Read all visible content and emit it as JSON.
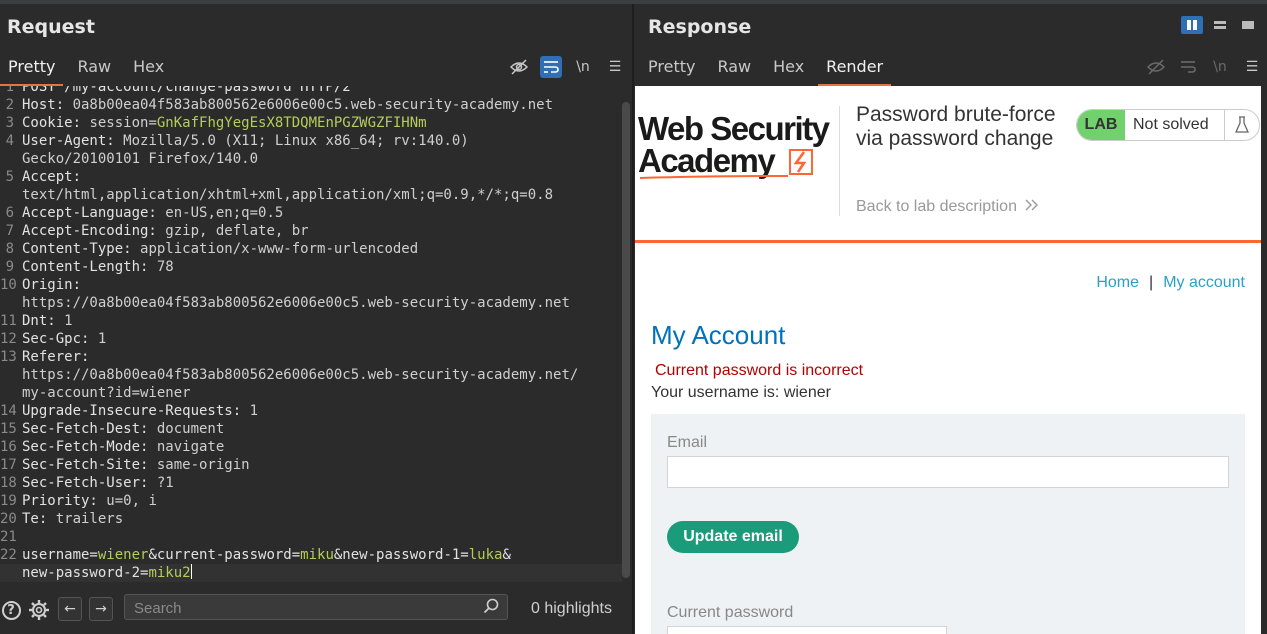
{
  "request": {
    "title": "Request",
    "tabs": [
      "Pretty",
      "Raw",
      "Hex"
    ],
    "active_tab": "Pretty",
    "tool_newline": "\\n",
    "lines": [
      {
        "n": "1",
        "parts": [
          [
            "k",
            "POST /my-account/change-password HTTP/2"
          ]
        ]
      },
      {
        "n": "2",
        "parts": [
          [
            "k",
            "Host: "
          ],
          [
            "v",
            "0a8b00ea04f583ab800562e6006e00c5.web-security-academy.net"
          ]
        ]
      },
      {
        "n": "3",
        "parts": [
          [
            "k",
            "Cookie: "
          ],
          [
            "v",
            "session="
          ],
          [
            "g",
            "GnKafFhgYegEsX8TDQMEnPGZWGZFIHNm"
          ]
        ]
      },
      {
        "n": "4",
        "parts": [
          [
            "k",
            "User-Agent: "
          ],
          [
            "v",
            "Mozilla/5.0 (X11; Linux x86_64; rv:140.0)"
          ]
        ]
      },
      {
        "n": "",
        "parts": [
          [
            "v",
            "Gecko/20100101 Firefox/140.0"
          ]
        ]
      },
      {
        "n": "5",
        "parts": [
          [
            "k",
            "Accept:"
          ]
        ]
      },
      {
        "n": "",
        "parts": [
          [
            "v",
            "text/html,application/xhtml+xml,application/xml;q=0.9,*/*;q=0.8"
          ]
        ]
      },
      {
        "n": "6",
        "parts": [
          [
            "k",
            "Accept-Language: "
          ],
          [
            "v",
            "en-US,en;q=0.5"
          ]
        ]
      },
      {
        "n": "7",
        "parts": [
          [
            "k",
            "Accept-Encoding: "
          ],
          [
            "v",
            "gzip, deflate, br"
          ]
        ]
      },
      {
        "n": "8",
        "parts": [
          [
            "k",
            "Content-Type: "
          ],
          [
            "v",
            "application/x-www-form-urlencoded"
          ]
        ]
      },
      {
        "n": "9",
        "parts": [
          [
            "k",
            "Content-Length: "
          ],
          [
            "v",
            "78"
          ]
        ]
      },
      {
        "n": "10",
        "parts": [
          [
            "k",
            "Origin:"
          ]
        ]
      },
      {
        "n": "",
        "parts": [
          [
            "v",
            "https://0a8b00ea04f583ab800562e6006e00c5.web-security-academy.net"
          ]
        ]
      },
      {
        "n": "11",
        "parts": [
          [
            "k",
            "Dnt: "
          ],
          [
            "v",
            "1"
          ]
        ]
      },
      {
        "n": "12",
        "parts": [
          [
            "k",
            "Sec-Gpc: "
          ],
          [
            "v",
            "1"
          ]
        ]
      },
      {
        "n": "13",
        "parts": [
          [
            "k",
            "Referer:"
          ]
        ]
      },
      {
        "n": "",
        "parts": [
          [
            "v",
            "https://0a8b00ea04f583ab800562e6006e00c5.web-security-academy.net/"
          ]
        ]
      },
      {
        "n": "",
        "parts": [
          [
            "v",
            "my-account?id=wiener"
          ]
        ]
      },
      {
        "n": "14",
        "parts": [
          [
            "k",
            "Upgrade-Insecure-Requests: "
          ],
          [
            "v",
            "1"
          ]
        ]
      },
      {
        "n": "15",
        "parts": [
          [
            "k",
            "Sec-Fetch-Dest: "
          ],
          [
            "v",
            "document"
          ]
        ]
      },
      {
        "n": "16",
        "parts": [
          [
            "k",
            "Sec-Fetch-Mode: "
          ],
          [
            "v",
            "navigate"
          ]
        ]
      },
      {
        "n": "17",
        "parts": [
          [
            "k",
            "Sec-Fetch-Site: "
          ],
          [
            "v",
            "same-origin"
          ]
        ]
      },
      {
        "n": "18",
        "parts": [
          [
            "k",
            "Sec-Fetch-User: "
          ],
          [
            "v",
            "?1"
          ]
        ]
      },
      {
        "n": "19",
        "parts": [
          [
            "k",
            "Priority: "
          ],
          [
            "v",
            "u=0, i"
          ]
        ]
      },
      {
        "n": "20",
        "parts": [
          [
            "k",
            "Te: "
          ],
          [
            "v",
            "trailers"
          ]
        ]
      },
      {
        "n": "21",
        "parts": []
      },
      {
        "n": "22",
        "parts": [
          [
            "k",
            "username="
          ],
          [
            "g",
            "wiener"
          ],
          [
            "k",
            "&current-password="
          ],
          [
            "g",
            "miku"
          ],
          [
            "k",
            "&new-password-1="
          ],
          [
            "g",
            "luka"
          ],
          [
            "k",
            "&"
          ]
        ]
      },
      {
        "n": "",
        "parts": [
          [
            "k",
            "new-password-2="
          ],
          [
            "g",
            "miku2"
          ]
        ]
      }
    ],
    "search_placeholder": "Search",
    "highlights": "0 highlights"
  },
  "response": {
    "title": "Response",
    "tabs": [
      "Pretty",
      "Raw",
      "Hex",
      "Render"
    ],
    "active_tab": "Render",
    "tool_newline": "\\n",
    "page": {
      "logo_line1": "Web Security",
      "logo_line2": "Academy",
      "lab_title": "Password brute-force via password change",
      "back_link": "Back to lab description",
      "lab_badge": "LAB",
      "lab_status": "Not solved",
      "nav_home": "Home",
      "nav_sep": "|",
      "nav_account": "My account",
      "heading": "My Account",
      "error": "Current password is incorrect",
      "username_text": "Your username is: wiener",
      "email_label": "Email",
      "update_button": "Update email",
      "current_password_label": "Current password"
    }
  },
  "colors": {
    "accent_tab": "#e8743b",
    "toggle_on": "#2f6fb5",
    "value_green": "#b5cc5b",
    "wsa_orange": "#ff6633",
    "lab_green": "#70d16d",
    "link_blue": "#29a0c8",
    "heading_blue": "#0071bc",
    "error_red": "#b50000",
    "button_teal": "#1a9b7a"
  }
}
